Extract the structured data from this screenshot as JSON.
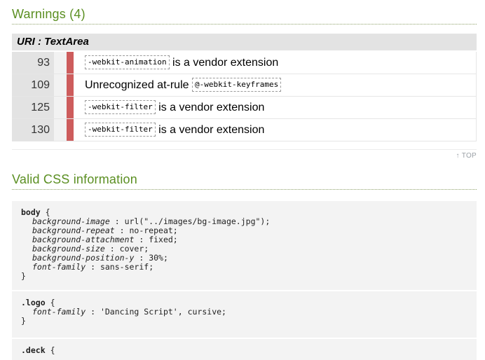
{
  "warnings": {
    "title": "Warnings (4)",
    "uri_label": "URI : TextArea",
    "rows": [
      {
        "line": "93",
        "pre": "",
        "code": "-webkit-animation",
        "post": "is a vendor extension"
      },
      {
        "line": "109",
        "pre": "Unrecognized at-rule",
        "code": "@-webkit-keyframes",
        "post": ""
      },
      {
        "line": "125",
        "pre": "",
        "code": "-webkit-filter",
        "post": "is a vendor extension"
      },
      {
        "line": "130",
        "pre": "",
        "code": "-webkit-filter",
        "post": "is a vendor extension"
      }
    ],
    "top_link": "↑ TOP"
  },
  "valid": {
    "title": "Valid CSS information",
    "body_rule": {
      "selector": "body",
      "open": "{",
      "close": "}",
      "decls": [
        {
          "prop": "background-image",
          "sep": " : ",
          "val": "url(\"../images/bg-image.jpg\");"
        },
        {
          "prop": "background-repeat",
          "sep": " : ",
          "val": "no-repeat;"
        },
        {
          "prop": "background-attachment",
          "sep": " : ",
          "val": "fixed;"
        },
        {
          "prop": "background-size",
          "sep": " : ",
          "val": "cover;"
        },
        {
          "prop": "background-position-y",
          "sep": " : ",
          "val": "30%;"
        },
        {
          "prop": "font-family",
          "sep": " : ",
          "val": "sans-serif;"
        }
      ]
    },
    "logo_rule": {
      "selector": ".logo",
      "open": "{",
      "close": "}",
      "decls": [
        {
          "prop": "font-family",
          "sep": " : ",
          "val": "'Dancing Script', cursive;"
        }
      ]
    },
    "next_rule": {
      "selector": ".deck",
      "open": "{"
    }
  },
  "colors": {
    "accent": "#5b8f22",
    "marker": "#cd5c5c",
    "row_bg": "#e3e3e3",
    "code_bg": "#f3f3f3"
  }
}
